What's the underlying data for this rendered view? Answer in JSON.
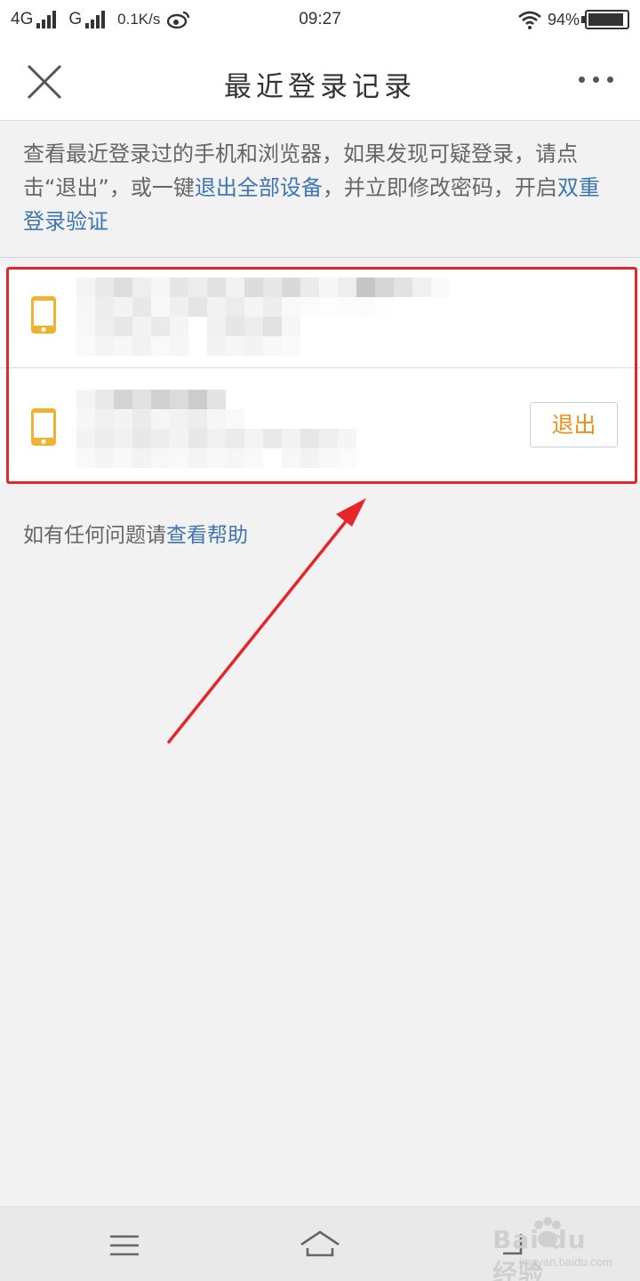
{
  "status_bar": {
    "network_1": "4G",
    "network_2": "G",
    "speed": "0.1K/s",
    "time": "09:27",
    "battery": "94%",
    "battery_level": 0.94
  },
  "header": {
    "title": "最近登录记录"
  },
  "description": {
    "part1": "查看最近登录过的手机和浏览器，如果发现可疑登录，请点击“退出”，或一键",
    "link1": "退出全部设备",
    "part2": "，并立即修改密码，开启",
    "link2": "双重登录验证"
  },
  "devices": [
    {
      "action": ""
    },
    {
      "action": "退出"
    }
  ],
  "help": {
    "prefix": "如有任何问题请",
    "link": "查看帮助"
  },
  "watermark": {
    "brand": "Bai du 经验",
    "url": "jingyan.baidu.com"
  },
  "colors": {
    "accent_link": "#3f75b1",
    "device_icon": "#f0b330",
    "logout_text": "#e99215",
    "annotation_red": "#e5262b"
  }
}
